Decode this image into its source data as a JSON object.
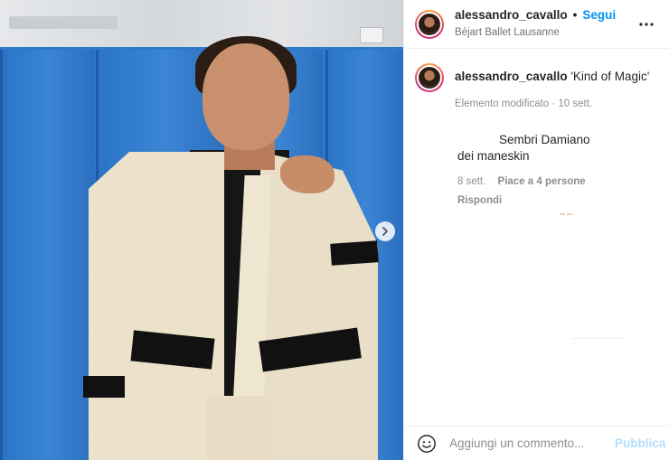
{
  "post": {
    "author": {
      "username": "alessandro_cavallo",
      "location": "Béjart Ballet Lausanne",
      "follow_separator": "•",
      "follow_label": "Segui",
      "more_icon": "more-horizontal-icon"
    },
    "caption": {
      "username": "alessandro_cavallo",
      "text": "'Kind of Magic'",
      "meta": "Elemento modificato · 10 sett."
    },
    "comments": [
      {
        "text_line1": "Sembri Damiano",
        "text_line2": "dei maneskin",
        "time": "8 sett.",
        "likes": "Piace a 4 persone",
        "reply_label": "Rispondi"
      }
    ],
    "carousel": {
      "next_icon": "chevron-right-icon"
    }
  },
  "composer": {
    "emoji_icon": "smiley-icon",
    "placeholder": "Aggiungi un commento...",
    "publish_label": "Pubblica"
  },
  "colors": {
    "accent": "#0095f6",
    "publish_disabled": "#b2dffc",
    "muted": "#8e8e8e"
  }
}
